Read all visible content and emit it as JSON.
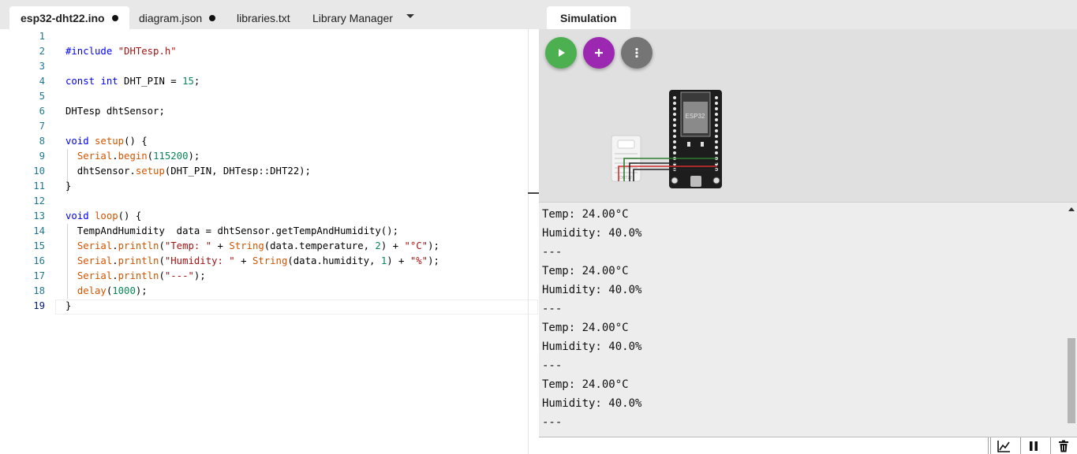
{
  "editor": {
    "tabs": [
      {
        "label": "esp32-dht22.ino",
        "modified": true,
        "active": true
      },
      {
        "label": "diagram.json",
        "modified": true,
        "active": false
      },
      {
        "label": "libraries.txt",
        "modified": false,
        "active": false
      },
      {
        "label": "Library Manager",
        "modified": false,
        "active": false
      }
    ],
    "line_numbers": [
      "1",
      "2",
      "3",
      "4",
      "5",
      "6",
      "7",
      "8",
      "9",
      "10",
      "11",
      "12",
      "13",
      "14",
      "15",
      "16",
      "17",
      "18",
      "19"
    ]
  },
  "simulation": {
    "tab_label": "Simulation",
    "buttons": {
      "play": "play-icon",
      "add": "plus-icon",
      "more": "more-vertical-icon"
    },
    "board_label": "ESP32",
    "sensor_label": "DHT22",
    "colors": {
      "play": "#4caf50",
      "add": "#9c27b0",
      "more": "#757575",
      "wire_green": "#2e7d32",
      "wire_red": "#d32f2f",
      "wire_black": "#222222"
    }
  },
  "serial_monitor": {
    "lines": [
      "Temp: 24.00°C",
      "Humidity: 40.0%",
      "---",
      "Temp: 24.00°C",
      "Humidity: 40.0%",
      "---",
      "Temp: 24.00°C",
      "Humidity: 40.0%",
      "---",
      "Temp: 24.00°C",
      "Humidity: 40.0%",
      "---"
    ],
    "input_value": "",
    "toolbar": {
      "chart": "chart-icon",
      "pause": "pause-icon",
      "clear": "trash-icon"
    }
  }
}
